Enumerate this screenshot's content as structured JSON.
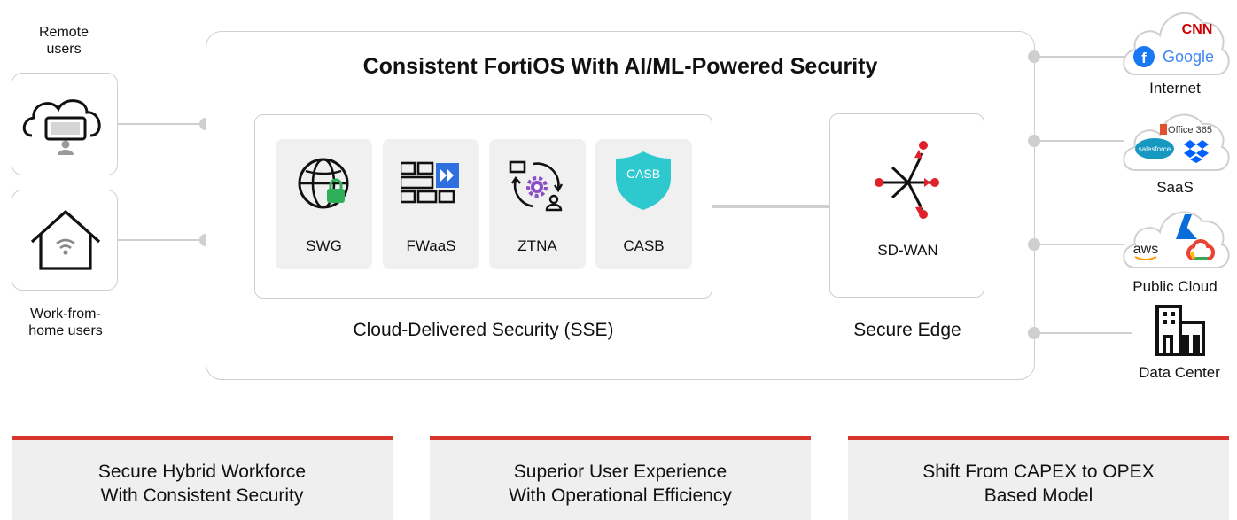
{
  "title": "Consistent FortiOS With AI/ML-Powered Security",
  "left": {
    "remote_label_1": "Remote",
    "remote_label_2": "users",
    "wfh_label_1": "Work-from-",
    "wfh_label_2": "home users"
  },
  "sse": {
    "caption": "Cloud-Delivered Security (SSE)",
    "tiles": [
      {
        "label": "SWG",
        "icon": "globe-lock-icon"
      },
      {
        "label": "FWaaS",
        "icon": "firewall-icon"
      },
      {
        "label": "ZTNA",
        "icon": "zero-trust-icon"
      },
      {
        "label": "CASB",
        "icon": "shield-icon",
        "badge": "CASB"
      }
    ]
  },
  "edge": {
    "caption": "Secure Edge",
    "label": "SD-WAN"
  },
  "destinations": {
    "internet": {
      "label": "Internet",
      "brands": [
        "CNN",
        "Google"
      ]
    },
    "saas": {
      "label": "SaaS",
      "brands": [
        "Office 365",
        "salesforce"
      ]
    },
    "cloud": {
      "label": "Public Cloud",
      "brands": [
        "aws"
      ]
    },
    "dc": {
      "label": "Data Center"
    }
  },
  "benefits": [
    {
      "line1": "Secure Hybrid Workforce",
      "line2": "With Consistent Security"
    },
    {
      "line1": "Superior User Experience",
      "line2": "With Operational Efficiency"
    },
    {
      "line1": "Shift From CAPEX to OPEX",
      "line2": "Based Model"
    }
  ],
  "colors": {
    "accent": "#d9362b",
    "sdwan_red": "#e0202a",
    "casb_teal": "#2ec9cf",
    "ztna_purple": "#8a4fc7",
    "firewall_blue": "#2f6fe0",
    "lock_green": "#2fae5a"
  }
}
